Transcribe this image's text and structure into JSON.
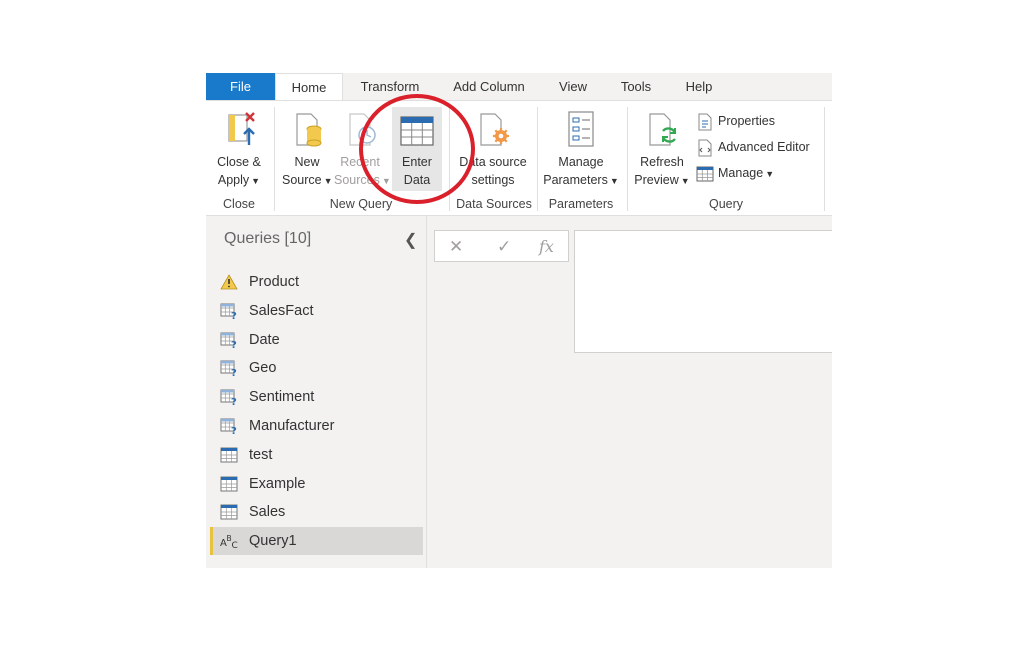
{
  "tabs": [
    "File",
    "Home",
    "Transform",
    "Add Column",
    "View",
    "Tools",
    "Help"
  ],
  "ribbon": {
    "close_apply": {
      "line1": "Close &",
      "line2": "Apply"
    },
    "new_source": {
      "line1": "New",
      "line2": "Source"
    },
    "recent_sources": {
      "line1": "Recent",
      "line2": "Sources"
    },
    "enter_data": {
      "line1": "Enter",
      "line2": "Data"
    },
    "data_source_settings": {
      "line1": "Data source",
      "line2": "settings"
    },
    "manage_parameters": {
      "line1": "Manage",
      "line2": "Parameters"
    },
    "refresh_preview": {
      "line1": "Refresh",
      "line2": "Preview"
    },
    "properties": "Properties",
    "advanced_editor": "Advanced Editor",
    "manage": "Manage",
    "groups": {
      "close": "Close",
      "new_query": "New Query",
      "data_sources": "Data Sources",
      "parameters": "Parameters",
      "query": "Query"
    }
  },
  "queries": {
    "title": "Queries [10]",
    "items": [
      {
        "name": "Product",
        "icon": "warning-icon"
      },
      {
        "name": "SalesFact",
        "icon": "table-question-icon"
      },
      {
        "name": "Date",
        "icon": "table-question-icon"
      },
      {
        "name": "Geo",
        "icon": "table-question-icon"
      },
      {
        "name": "Sentiment",
        "icon": "table-question-icon"
      },
      {
        "name": "Manufacturer",
        "icon": "table-question-icon"
      },
      {
        "name": "test",
        "icon": "table-icon"
      },
      {
        "name": "Example",
        "icon": "table-icon"
      },
      {
        "name": "Sales",
        "icon": "table-icon"
      },
      {
        "name": "Query1",
        "icon": "abc-text-icon"
      }
    ],
    "selected": "Query1"
  },
  "formula_bar": {
    "fx": "fx"
  },
  "colors": {
    "file_tab": "#1979ca",
    "annotation": "#d9202b",
    "selected_marker": "#e8c23c",
    "icon_blue": "#2b6cb0"
  }
}
